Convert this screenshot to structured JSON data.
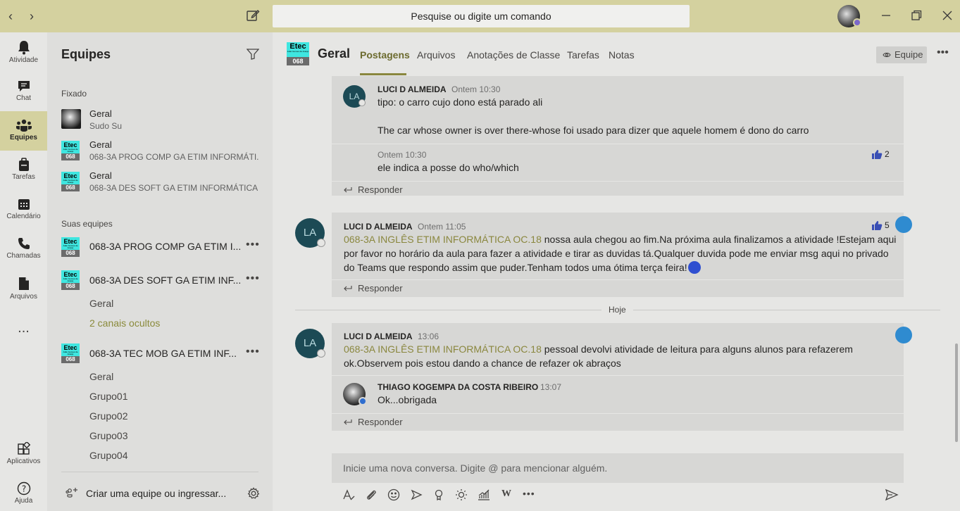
{
  "titlebar": {
    "search_placeholder": "Pesquise ou digite um comando"
  },
  "rail": {
    "items": [
      {
        "label": "Atividade",
        "icon": "bell-icon"
      },
      {
        "label": "Chat",
        "icon": "chat-icon"
      },
      {
        "label": "Equipes",
        "icon": "teams-icon"
      },
      {
        "label": "Tarefas",
        "icon": "assignments-icon"
      },
      {
        "label": "Calendário",
        "icon": "calendar-icon"
      },
      {
        "label": "Chamadas",
        "icon": "phone-icon"
      },
      {
        "label": "Arquivos",
        "icon": "files-icon"
      },
      {
        "label": "Aplicativos",
        "icon": "apps-icon"
      },
      {
        "label": "Ajuda",
        "icon": "help-icon"
      }
    ],
    "more": "..."
  },
  "teams_panel": {
    "title": "Equipes",
    "pinned_label": "Fixado",
    "pinned": [
      {
        "name": "Geral",
        "sub": "Sudo Su"
      },
      {
        "name": "Geral",
        "sub": "068-3A PROG COMP GA ETIM INFORMÁTI..."
      },
      {
        "name": "Geral",
        "sub": "068-3A DES SOFT GA ETIM INFORMÁTICA ..."
      }
    ],
    "your_teams_label": "Suas equipes",
    "teams": [
      {
        "name": "068-3A PROG COMP GA ETIM I..."
      },
      {
        "name": "068-3A DES SOFT GA ETIM INF..."
      },
      {
        "name": "068-3A TEC MOB GA ETIM INF..."
      }
    ],
    "des_soft_channels": [
      "Geral",
      "2 canais ocultos"
    ],
    "tec_mob_channels": [
      "Geral",
      "Grupo01",
      "Grupo02",
      "Grupo03",
      "Grupo04"
    ],
    "logo": {
      "top": "Etec",
      "small": "João Gomes de Araújo",
      "bottom": "068"
    },
    "footer": "Criar uma equipe ou ingressar..."
  },
  "header": {
    "title": "Geral",
    "tabs": [
      "Postagens",
      "Arquivos",
      "Anotações de Classe",
      "Tarefas",
      "Notas"
    ],
    "team_button": "Equipe"
  },
  "feed": {
    "thread1": {
      "author": "LUCI D ALMEIDA",
      "time": "Ontem 10:30",
      "line1": "tipo: o carro cujo dono está parado ali",
      "line2": "The car whose owner is over there-whose foi usado para dizer que aquele homem é dono do carro",
      "reply_time": "Ontem 10:30",
      "reply_text": "ele indica a posse do who/which",
      "reply_likes": "2",
      "reply_label": "Responder",
      "avatar": "LA"
    },
    "thread2": {
      "author": "LUCI D ALMEIDA",
      "time": "Ontem 11:05",
      "mention": "068-3A INGLÊS ETIM INFORMÁTICA OC.18",
      "text1": " nossa aula chegou ao fim.Na próxima aula finalizamos a atividade !Estejam aqui",
      "text2": "por favor no horário da aula para fazer a atividade e tirar as duvidas tá.Qualquer duvida pode me enviar msg aqui no privado",
      "text3": "do Teams que respondo assim que puder.Tenham todos uma ótima terça feira!",
      "likes": "5",
      "reply_label": "Responder",
      "avatar": "LA"
    },
    "day_label": "Hoje",
    "thread3": {
      "author": "LUCI D ALMEIDA",
      "time": "13:06",
      "mention": "068-3A INGLÊS ETIM INFORMÁTICA OC.18",
      "text1": " pessoal devolvi atividade de leitura para alguns alunos para refazerem",
      "text2": "ok.Observem pois estou dando a chance de refazer ok  abraços",
      "reply_author": "THIAGO KOGEMPA DA COSTA RIBEIRO",
      "reply_time": "13:07",
      "reply_text": "Ok...obrigada",
      "reply_label": "Responder",
      "avatar": "LA"
    }
  },
  "composer": {
    "placeholder": "Inicie uma nova conversa. Digite @ para mencionar alguém."
  }
}
